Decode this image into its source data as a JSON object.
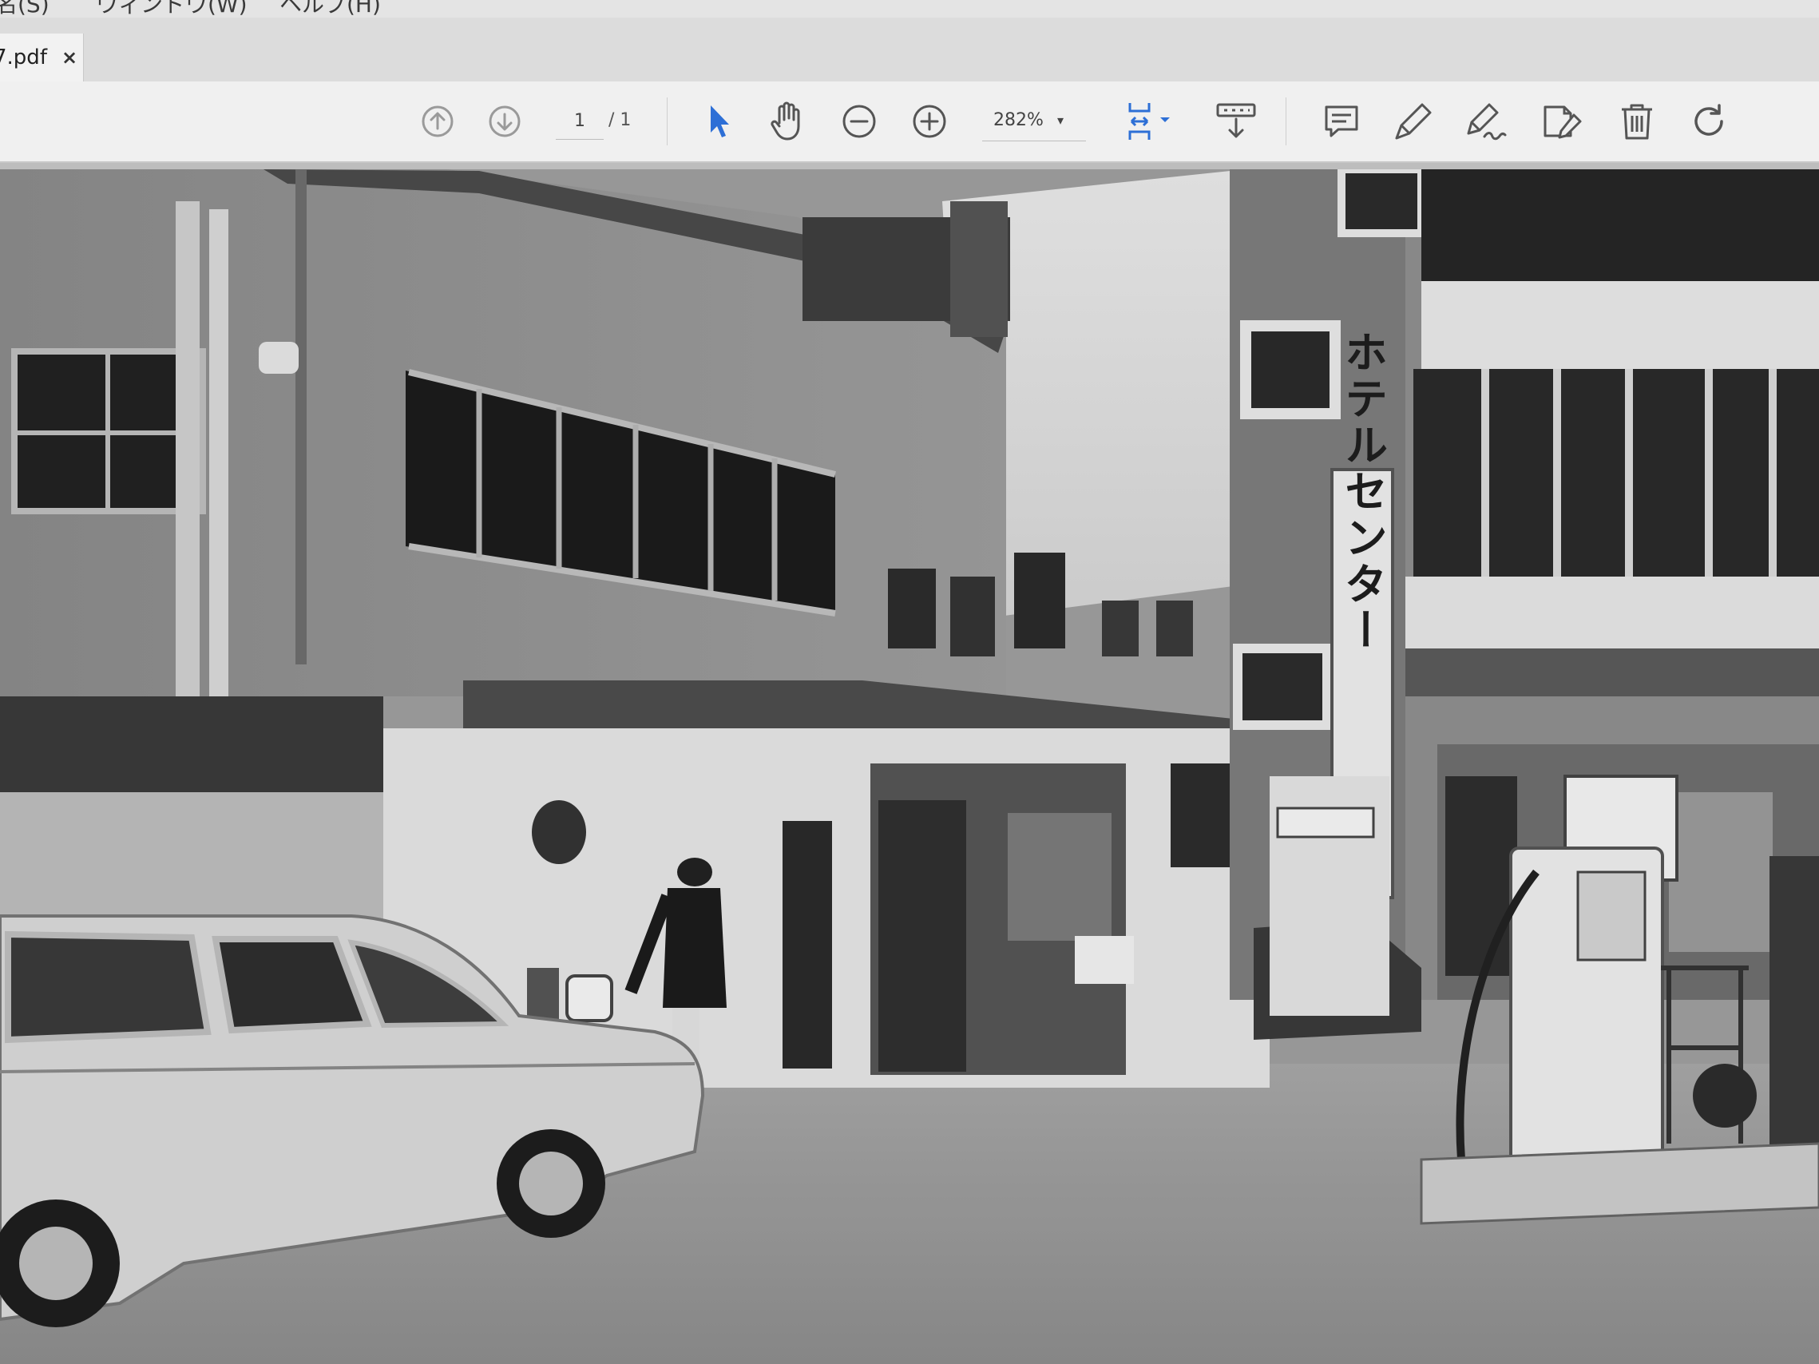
{
  "menu": {
    "items": [
      "名(S)",
      "ウィンドウ(W)",
      "ヘルプ(H)"
    ]
  },
  "tab": {
    "title": "7.pdf",
    "close_label": "×"
  },
  "toolbar": {
    "page_current": "1",
    "page_total": "/ 1",
    "zoom": "282%",
    "zoom_caret": "▾"
  },
  "photo": {
    "vertical_sign": "ホテルセンター"
  },
  "colors": {
    "accent": "#2d6fd6",
    "icon": "#555555",
    "toolbar_bg": "#f0f0f0"
  },
  "icons": [
    "previous-page-icon",
    "next-page-icon",
    "select-arrow-icon",
    "hand-icon",
    "zoom-out-icon",
    "zoom-in-icon",
    "fit-page-icon",
    "scroll-mode-icon",
    "comment-icon",
    "highlight-pen-icon",
    "sign-icon",
    "edit-pdf-icon",
    "delete-icon",
    "rotate-icon"
  ]
}
